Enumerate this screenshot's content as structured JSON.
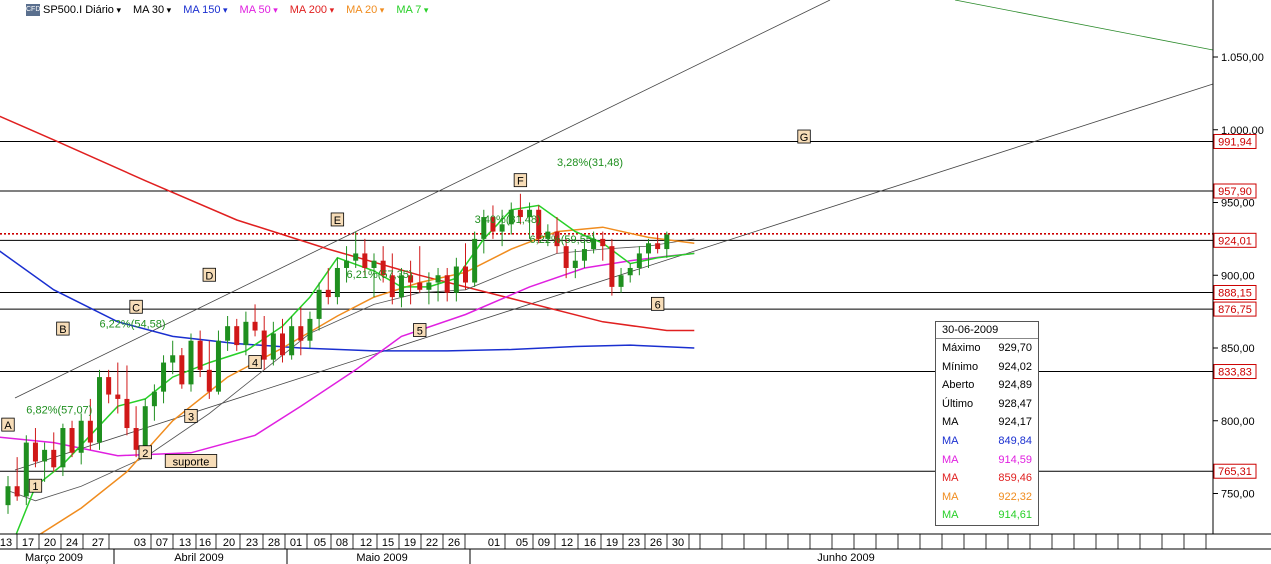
{
  "legend": {
    "badge": "CFD",
    "symbol": "SP500.I Diário",
    "items": [
      {
        "label": "MA 30",
        "color": "#000000"
      },
      {
        "label": "MA 150",
        "color": "#1a2fd0"
      },
      {
        "label": "MA 50",
        "color": "#e020e0"
      },
      {
        "label": "MA 200",
        "color": "#e02020"
      },
      {
        "label": "MA 20",
        "color": "#f08c1e"
      },
      {
        "label": "MA 7",
        "color": "#28d028"
      }
    ]
  },
  "info_box": {
    "date": "30-06-2009",
    "rows": [
      {
        "label": "Máximo",
        "value": "929,70",
        "color": "#000000"
      },
      {
        "label": "Mínimo",
        "value": "924,02",
        "color": "#000000"
      },
      {
        "label": "Aberto",
        "value": "924,89",
        "color": "#000000"
      },
      {
        "label": "Último",
        "value": "928,47",
        "color": "#000000"
      },
      {
        "label": "MA",
        "value": "924,17",
        "color": "#000000"
      },
      {
        "label": "MA",
        "value": "849,84",
        "color": "#1a2fd0"
      },
      {
        "label": "MA",
        "value": "914,59",
        "color": "#e020e0"
      },
      {
        "label": "MA",
        "value": "859,46",
        "color": "#e02020"
      },
      {
        "label": "MA",
        "value": "922,32",
        "color": "#f08c1e"
      },
      {
        "label": "MA",
        "value": "914,61",
        "color": "#28d028"
      }
    ]
  },
  "chart_data": {
    "type": "candlestick",
    "y_ticks": [
      {
        "value": 750,
        "label": "750,00"
      },
      {
        "value": 800,
        "label": "800,00"
      },
      {
        "value": 850,
        "label": "850,00"
      },
      {
        "value": 900,
        "label": "900,00"
      },
      {
        "value": 950,
        "label": "950,00"
      },
      {
        "value": 1000,
        "label": "1.000,00"
      },
      {
        "value": 1050,
        "label": "1.050,00"
      }
    ],
    "price_lines": [
      {
        "value": 991.94,
        "label": "991,94"
      },
      {
        "value": 957.9,
        "label": "957,90"
      },
      {
        "value": 924.01,
        "label": "924,01"
      },
      {
        "value": 888.15,
        "label": "888,15"
      },
      {
        "value": 876.75,
        "label": "876,75"
      },
      {
        "value": 833.83,
        "label": "833,83"
      },
      {
        "value": 765.31,
        "label": "765,31"
      }
    ],
    "current_price_line": 928.47,
    "day_ticks": [
      "13",
      "17",
      "20",
      "24",
      "27",
      "03",
      "07",
      "13",
      "16",
      "20",
      "23",
      "28",
      "01",
      "05",
      "08",
      "12",
      "15",
      "19",
      "22",
      "26",
      "01",
      "05",
      "09",
      "12",
      "16",
      "19",
      "23",
      "26",
      "30"
    ],
    "months": [
      "Março 2009",
      "Abril 2009",
      "Maio 2009",
      "Junho 2009"
    ],
    "ohlc": [
      [
        742,
        762,
        736,
        755
      ],
      [
        755,
        775,
        745,
        748
      ],
      [
        748,
        790,
        742,
        785
      ],
      [
        785,
        795,
        768,
        772
      ],
      [
        772,
        785,
        758,
        780
      ],
      [
        780,
        792,
        765,
        768
      ],
      [
        768,
        798,
        762,
        795
      ],
      [
        795,
        800,
        775,
        778
      ],
      [
        778,
        805,
        770,
        800
      ],
      [
        800,
        815,
        780,
        785
      ],
      [
        785,
        835,
        780,
        830
      ],
      [
        830,
        835,
        812,
        818
      ],
      [
        818,
        840,
        805,
        815
      ],
      [
        815,
        838,
        790,
        795
      ],
      [
        795,
        810,
        775,
        780
      ],
      [
        780,
        815,
        775,
        810
      ],
      [
        810,
        825,
        800,
        820
      ],
      [
        820,
        845,
        812,
        840
      ],
      [
        840,
        855,
        832,
        845
      ],
      [
        845,
        850,
        822,
        825
      ],
      [
        825,
        860,
        820,
        855
      ],
      [
        855,
        862,
        830,
        835
      ],
      [
        835,
        855,
        815,
        820
      ],
      [
        820,
        862,
        818,
        855
      ],
      [
        855,
        872,
        848,
        865
      ],
      [
        865,
        870,
        848,
        852
      ],
      [
        852,
        875,
        845,
        868
      ],
      [
        868,
        880,
        858,
        862
      ],
      [
        862,
        872,
        835,
        842
      ],
      [
        842,
        868,
        838,
        860
      ],
      [
        860,
        870,
        840,
        845
      ],
      [
        845,
        872,
        842,
        865
      ],
      [
        865,
        878,
        845,
        855
      ],
      [
        855,
        875,
        850,
        870
      ],
      [
        870,
        895,
        862,
        890
      ],
      [
        890,
        905,
        880,
        885
      ],
      [
        885,
        912,
        880,
        905
      ],
      [
        905,
        920,
        895,
        910
      ],
      [
        910,
        930,
        905,
        915
      ],
      [
        915,
        925,
        900,
        905
      ],
      [
        905,
        915,
        885,
        910
      ],
      [
        910,
        920,
        895,
        900
      ],
      [
        900,
        915,
        880,
        885
      ],
      [
        885,
        905,
        878,
        900
      ],
      [
        900,
        910,
        880,
        895
      ],
      [
        895,
        920,
        888,
        890
      ],
      [
        890,
        902,
        880,
        895
      ],
      [
        895,
        905,
        882,
        900
      ],
      [
        900,
        905,
        882,
        888
      ],
      [
        888,
        912,
        882,
        906
      ],
      [
        906,
        922,
        890,
        895
      ],
      [
        895,
        930,
        892,
        925
      ],
      [
        925,
        945,
        915,
        940
      ],
      [
        940,
        948,
        925,
        930
      ],
      [
        930,
        945,
        920,
        935
      ],
      [
        935,
        950,
        928,
        945
      ],
      [
        945,
        956,
        935,
        940
      ],
      [
        940,
        950,
        925,
        945
      ],
      [
        945,
        948,
        922,
        925
      ],
      [
        925,
        935,
        920,
        930
      ],
      [
        930,
        940,
        915,
        920
      ],
      [
        920,
        925,
        898,
        905
      ],
      [
        905,
        918,
        898,
        910
      ],
      [
        910,
        925,
        905,
        918
      ],
      [
        918,
        930,
        915,
        925
      ],
      [
        925,
        930,
        910,
        920
      ],
      [
        920,
        925,
        886,
        892
      ],
      [
        892,
        905,
        888,
        900
      ],
      [
        900,
        908,
        895,
        905
      ],
      [
        905,
        920,
        900,
        915
      ],
      [
        915,
        925,
        905,
        922
      ],
      [
        922,
        928,
        915,
        918
      ],
      [
        918,
        930,
        912,
        928
      ]
    ],
    "sp500_close_ma_note": "",
    "annotations": [
      {
        "label": "A",
        "date_index": 0,
        "value": 797
      },
      {
        "label": "B",
        "date_index": 6,
        "value": 863
      },
      {
        "label": "C",
        "date_index": 14,
        "value": 878
      },
      {
        "label": "D",
        "date_index": 22,
        "value": 900
      },
      {
        "label": "E",
        "date_index": 36,
        "value": 938
      },
      {
        "label": "F",
        "date_index": 56,
        "value": 965
      },
      {
        "label": "G",
        "date_index": 87,
        "value": 995
      },
      {
        "label": "1",
        "date_index": 3,
        "value": 755
      },
      {
        "label": "2",
        "date_index": 15,
        "value": 778
      },
      {
        "label": "3",
        "date_index": 20,
        "value": 803
      },
      {
        "label": "4",
        "date_index": 27,
        "value": 840
      },
      {
        "label": "5",
        "date_index": 45,
        "value": 862
      },
      {
        "label": "6",
        "date_index": 71,
        "value": 880
      },
      {
        "label": "suporte",
        "date_index": 20,
        "value": 772
      }
    ],
    "measures": [
      {
        "label": "6,82%(57,07)",
        "date_index": 2,
        "value": 805
      },
      {
        "label": "6,22%(54,58)",
        "date_index": 10,
        "value": 864
      },
      {
        "label": "6,21%(57,35)",
        "date_index": 37,
        "value": 898
      },
      {
        "label": "3,40%(31,48)",
        "date_index": 51,
        "value": 936
      },
      {
        "label": "6,22%(59,55)",
        "date_index": 57,
        "value": 922
      },
      {
        "label": "3,28%(31,48)",
        "date_index": 60,
        "value": 975
      }
    ],
    "moving_averages": [
      {
        "name": "MA 200",
        "color": "#e02020",
        "points": [
          [
            -3,
            1015
          ],
          [
            5,
            993
          ],
          [
            15,
            965
          ],
          [
            25,
            938
          ],
          [
            35,
            918
          ],
          [
            45,
            900
          ],
          [
            55,
            884
          ],
          [
            65,
            868
          ],
          [
            72,
            862
          ],
          [
            75,
            862
          ]
        ]
      },
      {
        "name": "MA 150",
        "color": "#1a2fd0",
        "points": [
          [
            -3,
            926
          ],
          [
            5,
            890
          ],
          [
            12,
            868
          ],
          [
            18,
            858
          ],
          [
            25,
            853
          ],
          [
            32,
            850
          ],
          [
            40,
            848
          ],
          [
            48,
            848
          ],
          [
            55,
            849
          ],
          [
            62,
            851
          ],
          [
            68,
            852
          ],
          [
            75,
            850
          ]
        ]
      },
      {
        "name": "MA 50",
        "color": "#e020e0",
        "points": [
          [
            -3,
            790
          ],
          [
            5,
            785
          ],
          [
            12,
            776
          ],
          [
            20,
            778
          ],
          [
            27,
            790
          ],
          [
            32,
            810
          ],
          [
            38,
            835
          ],
          [
            43,
            858
          ],
          [
            50,
            873
          ],
          [
            57,
            892
          ],
          [
            63,
            905
          ],
          [
            68,
            910
          ],
          [
            72,
            913
          ],
          [
            75,
            915
          ]
        ]
      },
      {
        "name": "MA 30",
        "color": "#555555",
        "points": [
          [
            0,
            752
          ],
          [
            3,
            745
          ],
          [
            8,
            755
          ],
          [
            15,
            775
          ],
          [
            22,
            805
          ],
          [
            28,
            835
          ],
          [
            33,
            860
          ],
          [
            40,
            880
          ],
          [
            45,
            888
          ],
          [
            50,
            890
          ],
          [
            55,
            903
          ],
          [
            60,
            915
          ],
          [
            65,
            918
          ],
          [
            70,
            920
          ],
          [
            75,
            925
          ]
        ]
      },
      {
        "name": "MA 20",
        "color": "#f08c1e",
        "points": [
          [
            0,
            718
          ],
          [
            3,
            720
          ],
          [
            8,
            740
          ],
          [
            13,
            765
          ],
          [
            18,
            800
          ],
          [
            24,
            830
          ],
          [
            30,
            850
          ],
          [
            36,
            872
          ],
          [
            40,
            885
          ],
          [
            45,
            895
          ],
          [
            50,
            902
          ],
          [
            55,
            918
          ],
          [
            60,
            930
          ],
          [
            65,
            933
          ],
          [
            70,
            926
          ],
          [
            75,
            922
          ]
        ]
      },
      {
        "name": "MA 7",
        "color": "#28d028",
        "points": [
          [
            0,
            708
          ],
          [
            3,
            755
          ],
          [
            6,
            770
          ],
          [
            9,
            790
          ],
          [
            12,
            810
          ],
          [
            15,
            815
          ],
          [
            18,
            830
          ],
          [
            22,
            840
          ],
          [
            26,
            848
          ],
          [
            30,
            865
          ],
          [
            33,
            885
          ],
          [
            36,
            912
          ],
          [
            40,
            903
          ],
          [
            43,
            892
          ],
          [
            46,
            892
          ],
          [
            49,
            898
          ],
          [
            52,
            925
          ],
          [
            55,
            945
          ],
          [
            58,
            948
          ],
          [
            62,
            930
          ],
          [
            65,
            922
          ],
          [
            68,
            908
          ],
          [
            71,
            912
          ],
          [
            75,
            915
          ]
        ]
      }
    ]
  }
}
